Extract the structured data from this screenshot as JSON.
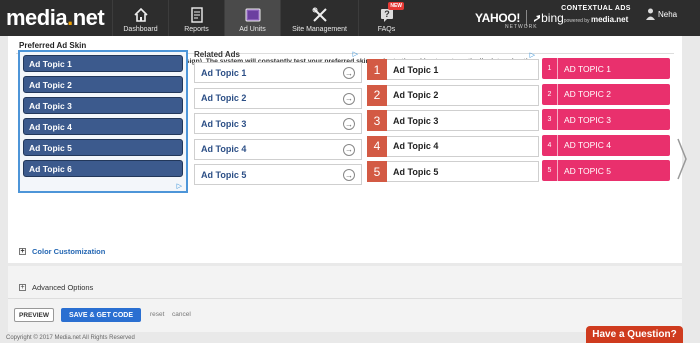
{
  "brand": {
    "name_main": "media",
    "name_dot": ".",
    "name_tail": "net"
  },
  "nav": [
    {
      "label": "Dashboard",
      "icon": "home-icon"
    },
    {
      "label": "Reports",
      "icon": "document-icon"
    },
    {
      "label": "Ad Units",
      "icon": "ad-units-icon"
    },
    {
      "label": "Site Management",
      "icon": "tools-icon"
    },
    {
      "label": "FAQs",
      "icon": "question-icon",
      "badge": "NEW"
    }
  ],
  "partner": {
    "yahoo": "YAHOO!",
    "bing": "bing",
    "network": "NETWORK"
  },
  "contextual": {
    "line1": "CONTEXTUAL ADS",
    "line2_prefix": "powered by",
    "line2_brand": "media.net"
  },
  "user": {
    "name": "Neha"
  },
  "section": {
    "title": "Preferred Ad Skin",
    "description": "Choose and customize your preferred ad skin (design), The system will constantly test your preferred skin against other skins to automatically determine the best performing option"
  },
  "skin1": {
    "items": [
      "Ad Topic 1",
      "Ad Topic 2",
      "Ad Topic 3",
      "Ad Topic 4",
      "Ad Topic 5",
      "Ad Topic 6"
    ]
  },
  "skin2": {
    "title": "Related Ads",
    "items": [
      "Ad Topic 1",
      "Ad Topic 2",
      "Ad Topic 3",
      "Ad Topic 4",
      "Ad Topic 5"
    ]
  },
  "skin3": {
    "items": [
      {
        "num": "1",
        "label": "Ad Topic 1"
      },
      {
        "num": "2",
        "label": "Ad Topic 2"
      },
      {
        "num": "3",
        "label": "Ad Topic 3"
      },
      {
        "num": "4",
        "label": "Ad Topic 4"
      },
      {
        "num": "5",
        "label": "Ad Topic 5"
      }
    ]
  },
  "skin4": {
    "items": [
      {
        "num": "1",
        "label": "AD TOPIC 1"
      },
      {
        "num": "2",
        "label": "AD TOPIC 2"
      },
      {
        "num": "3",
        "label": "AD TOPIC 3"
      },
      {
        "num": "4",
        "label": "AD TOPIC 4"
      },
      {
        "num": "5",
        "label": "AD TOPIC 5"
      }
    ]
  },
  "options": {
    "color": "Color Customization",
    "advanced": "Advanced Options",
    "expand_symbol": "+"
  },
  "actions": {
    "preview": "PREVIEW",
    "save": "SAVE & GET CODE",
    "reset": "reset",
    "cancel": "cancel"
  },
  "footer": {
    "copyright": "Copyright © 2017 Media.net All Rights Reserved"
  },
  "help": {
    "label": "Have a Question?"
  },
  "colors": {
    "skin1_item": "#3c5a8d",
    "skin3_number": "#d35a44",
    "skin4_item": "#e9306d",
    "primary_button": "#2a6fd1",
    "help_button": "#cf3b1e",
    "link": "#2467b3"
  }
}
